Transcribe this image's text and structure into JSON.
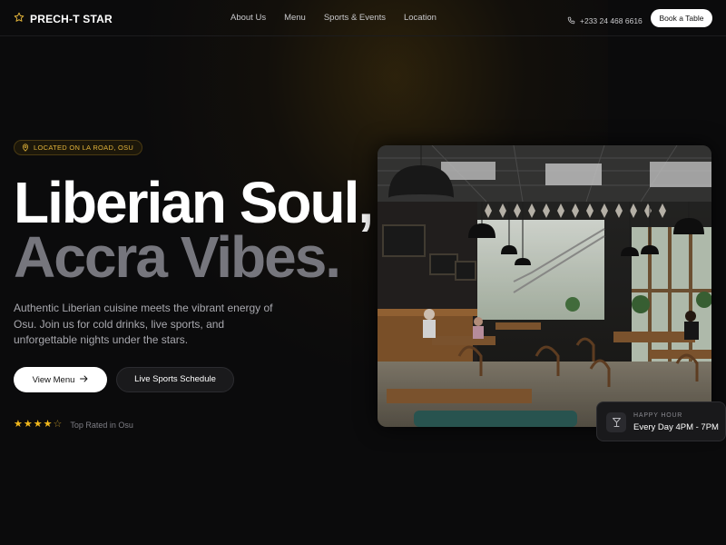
{
  "brand": {
    "name": "PRECH-T STAR",
    "accent": "#e0b23a"
  },
  "nav": {
    "links": [
      "About Us",
      "Menu",
      "Sports & Events",
      "Location"
    ],
    "phone": "+233 24 468 6616",
    "cta": "Book a Table"
  },
  "hero": {
    "badge": "LOCATED ON LA ROAD, OSU",
    "headline_line1": "Liberian Soul,",
    "headline_line2": "Accra Vibes.",
    "description": "Authentic Liberian cuisine meets the vibrant energy of Osu. Join us for cold drinks, live sports, and unforgettable nights under the stars.",
    "primary_button": "View Menu",
    "secondary_button": "Live Sports Schedule",
    "rating": {
      "stars_filled": 4,
      "stars_total": 5,
      "label": "Top Rated in Osu"
    }
  },
  "happy_hour": {
    "label": "HAPPY HOUR",
    "time": "Every Day 4PM - 7PM"
  },
  "icons": {
    "logo": "star-outline-icon",
    "phone": "phone-icon",
    "badge": "map-pin-icon",
    "primary_button": "arrow-right-icon",
    "happy_hour": "cocktail-glass-icon"
  }
}
